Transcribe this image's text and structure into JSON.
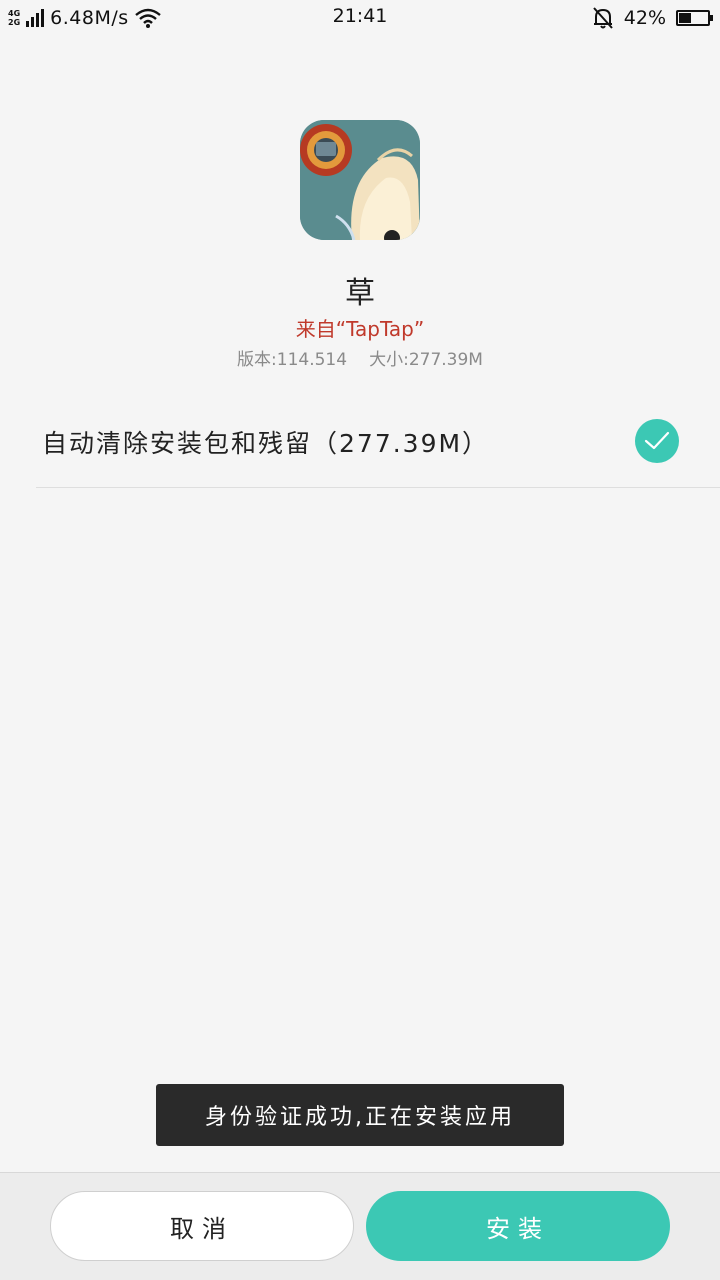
{
  "status_bar": {
    "network_type_top": "4G",
    "network_type_bottom": "2G",
    "speed": "6.48M/s",
    "time": "21:41",
    "battery_percent": "42%",
    "battery_level": 0.42,
    "icons": [
      "signal-icon",
      "wifi-icon",
      "mute-bell-icon",
      "battery-icon"
    ]
  },
  "app": {
    "name": "草",
    "source": "来自“TapTap”",
    "version_label": "版本:",
    "version": "114.514",
    "size_label": "大小:",
    "size": "277.39M"
  },
  "options": {
    "auto_clean_label": "自动清除安装包和残留（277.39M）",
    "auto_clean_checked": true
  },
  "toast": {
    "message": "身份验证成功,正在安装应用"
  },
  "buttons": {
    "cancel": "取消",
    "install": "安装"
  },
  "colors": {
    "accent": "#3cc8b4",
    "source_text": "#c0392b",
    "background": "#f5f5f5",
    "toast_bg": "#2a2a2a"
  }
}
